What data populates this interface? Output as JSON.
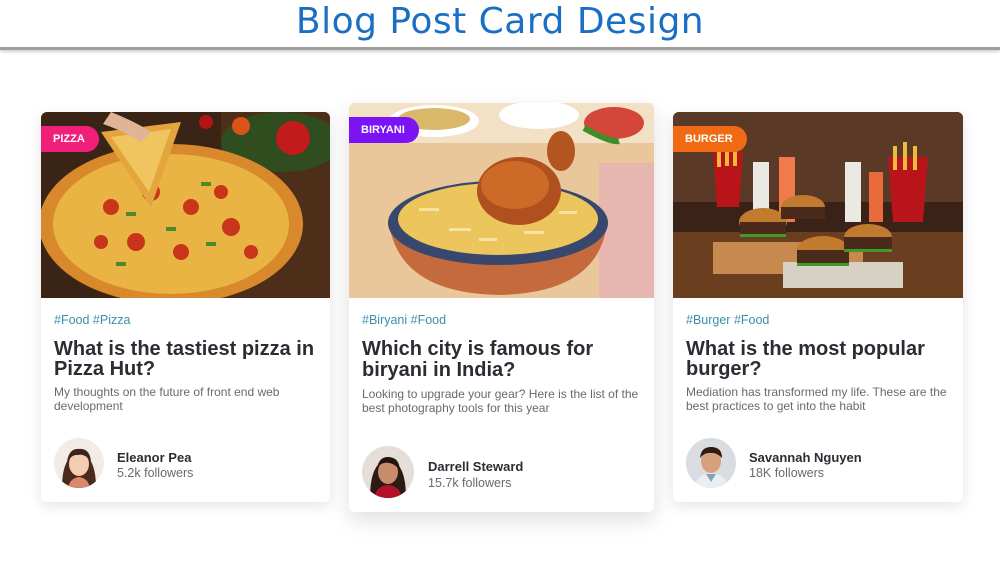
{
  "header": {
    "title": "Blog Post Card Design"
  },
  "cards": [
    {
      "tag": "Pizza",
      "tag_color": "#f0207a",
      "hashtags": "#Food #Pizza",
      "title": "What is the tastiest pizza in Pizza Hut?",
      "excerpt": "My thoughts on the future of front end web development",
      "author": {
        "name": "Eleanor Pea",
        "followers": "5.2k followers"
      },
      "image": "pizza-photo"
    },
    {
      "tag": "Biryani",
      "tag_color": "#7a14f5",
      "hashtags": "#Biryani #Food",
      "title": "Which city is famous for biryani in India?",
      "excerpt": "Looking to upgrade your gear? Here is the list of the best photography tools for this year",
      "author": {
        "name": "Darrell Steward",
        "followers": "15.7k followers"
      },
      "image": "biryani-photo"
    },
    {
      "tag": "Burger",
      "tag_color": "#f06a14",
      "hashtags": "#Burger #Food",
      "title": "What is the most popular burger?",
      "excerpt": "Mediation has transformed my life. These are the best practices to get into the habit",
      "author": {
        "name": "Savannah Nguyen",
        "followers": "18K followers"
      },
      "image": "burger-photo"
    }
  ]
}
